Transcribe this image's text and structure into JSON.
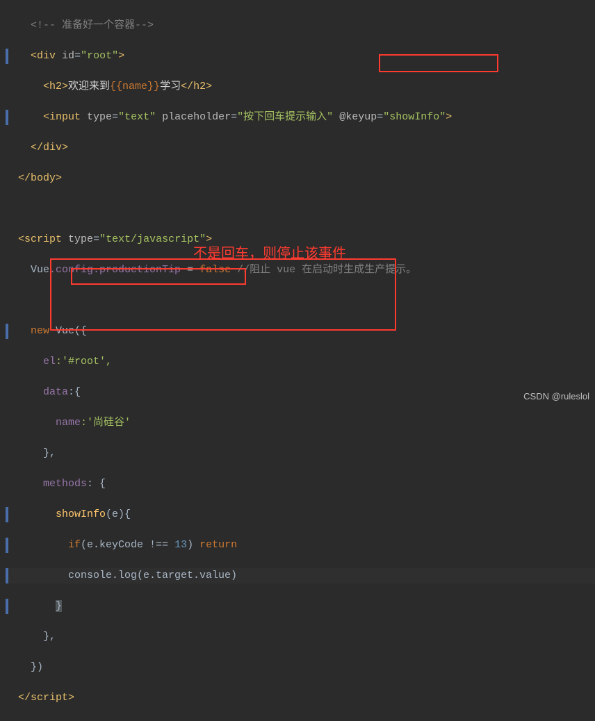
{
  "code": {
    "l1": "<!-- 准备好一个容器-->",
    "l2_tag_open": "<div",
    "l2_attr": "id",
    "l2_val": "\"root\"",
    "l2_close": ">",
    "l3_h2_open": "<h2>",
    "l3_text1": "欢迎来到",
    "l3_mustache": "{{name}}",
    "l3_text2": "学习",
    "l3_h2_close": "</h2>",
    "l4_tag": "<input",
    "l4_a1": "type",
    "l4_v1": "\"text\"",
    "l4_a2": "placeholder",
    "l4_v2": "\"按下回车提示输入\"",
    "l4_a3": "@keyup",
    "l4_v3": "\"showInfo\"",
    "l4_close": ">",
    "l5": "</div>",
    "l6": "</body>",
    "l8_open": "<script",
    "l8_attr": "type",
    "l8_val": "\"text/javascript\"",
    "l8_close": ">",
    "l9_a": "Vue",
    "l9_b": ".config.productionTip",
    "l9_c": " = ",
    "l9_false": "false",
    "l9_comment": " //阻止 vue 在启动时生成生产提示。",
    "l11_new": "new ",
    "l11_vue": "Vue",
    "l11_paren": "({",
    "l12_el": "el",
    "l12_elv": ":'#root',",
    "l13_data": "data",
    "l13_datac": ":{",
    "l14_name": "name",
    "l14_namev": ":'尚硅谷'",
    "l15": "},",
    "l16_methods": "methods",
    "l16_c": ": {",
    "l17_fn": "showInfo",
    "l17_arg": "(e){",
    "l18_if": "if",
    "l18_cond1": "(e.keyCode !== ",
    "l18_num": "13",
    "l18_cond2": ") ",
    "l18_ret": "return",
    "l19_console": "console",
    "l19_log": ".log(e.target.value)",
    "l20": "}",
    "l21": "},",
    "l22": "})",
    "l23": "</script>"
  },
  "annotations": {
    "note": "不是回车，则停止该事件",
    "watermark": "CSDN @ruleslol"
  }
}
